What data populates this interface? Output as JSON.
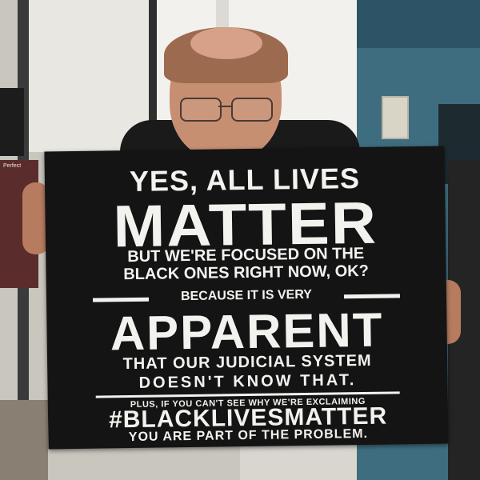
{
  "sign": {
    "line1": "YES, ALL LIVES",
    "line2": "MATTER",
    "line3": "BUT WE'RE FOCUSED ON THE",
    "line4": "BLACK ONES RIGHT NOW, OK?",
    "line5": "BECAUSE IT IS VERY",
    "line6": "APPARENT",
    "line7": "THAT OUR JUDICIAL SYSTEM",
    "line8": "DOESN'T KNOW THAT.",
    "line9": "PLUS, IF YOU CAN'T SEE WHY WE'RE EXCLAIMING",
    "line10": "#BLACKLIVESMATTER",
    "line11": "YOU ARE PART OF THE PROBLEM."
  },
  "background": {
    "poster_text": "Perfect"
  },
  "colors": {
    "sign_bg": "#141414",
    "sign_text": "#f2f2ee",
    "wall_blue": "#3f6d80"
  }
}
